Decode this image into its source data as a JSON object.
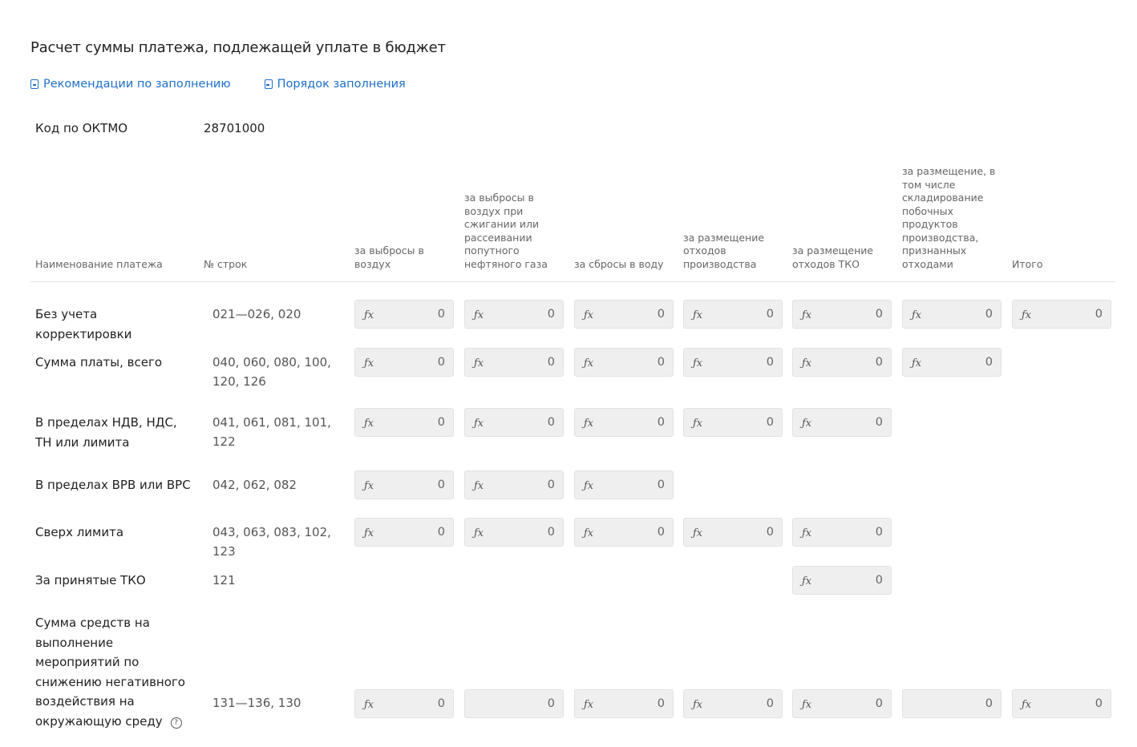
{
  "title": "Расчет суммы платежа, подлежащей уплате в бюджет",
  "links": [
    {
      "label": "Рекомендации по заполнению",
      "icon": "document-icon"
    },
    {
      "label": "Порядок заполнения",
      "icon": "document-icon"
    }
  ],
  "oktmo": {
    "label": "Код по ОКТМО",
    "value": "28701000"
  },
  "headers": {
    "name": "Наименование платежа",
    "lines": "№ строк",
    "c1": "за выбросы в воздух",
    "c2": "за выбросы в воздух при сжигании или рассеивании попутного нефтяного газа",
    "c3": "за сбросы в воду",
    "c4": "за размещение отходов производства",
    "c5": "за размещение отходов ТКО",
    "c6": "за размещение, в том числе складирование побочных продуктов производства, признанных отходами",
    "c7": "Итого"
  },
  "rows": [
    {
      "name": "Без учета корректировки",
      "lines": "021—026, 020"
    },
    {
      "name": "Сумма платы, всего",
      "lines": "040, 060, 080, 100, 120, 126"
    },
    {
      "name": "В пределах НДВ, НДС, ТН или лимита",
      "lines": "041, 061, 081, 101, 122"
    },
    {
      "name": "В пределах ВРВ или ВРС",
      "lines": "042, 062, 082"
    },
    {
      "name": "Сверх лимита",
      "lines": "043, 063, 083, 102, 123"
    },
    {
      "name": "За принятые ТКО",
      "lines": "121"
    },
    {
      "name": "Сумма средств на выполнение мероприятий по снижению негативного воздействия на окружающую среду",
      "lines": "131—136, 130"
    }
  ],
  "cell_value": "0",
  "fx_symbol": "fx",
  "help_symbol": "?"
}
